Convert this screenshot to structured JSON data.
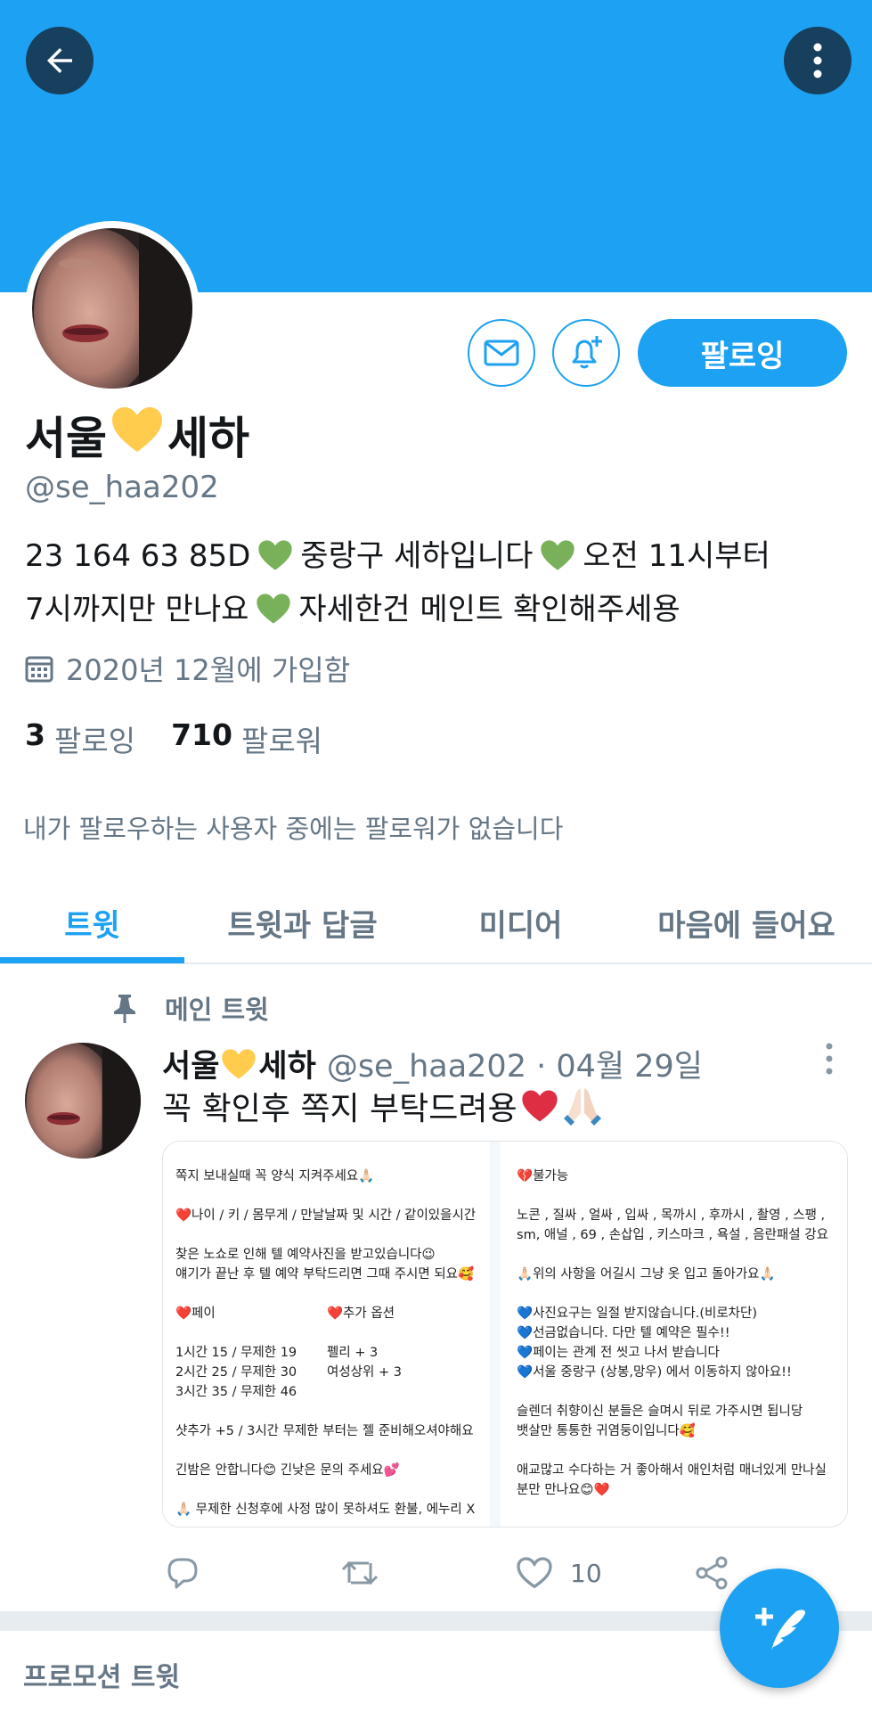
{
  "profile": {
    "display_name_part1": "서울",
    "display_name_part2": "세하",
    "handle": "@se_haa202",
    "bio_line1_a": "23 164 63 85D",
    "bio_line1_b": "중랑구 세하입니다",
    "bio_line1_c": "오전 11시부터",
    "bio_line2_a": "7시까지만 만나요",
    "bio_line2_b": "자세한건 메인트 확인해주세용",
    "joined": "2020년 12월에 가입함",
    "following_count": "3",
    "following_label": "팔로잉",
    "followers_count": "710",
    "followers_label": "팔로워",
    "mutual_note": "내가 팔로우하는 사용자 중에는 팔로워가 없습니다"
  },
  "actions": {
    "follow_button": "팔로잉"
  },
  "tabs": [
    {
      "label": "트윗"
    },
    {
      "label": "트윗과 답글"
    },
    {
      "label": "미디어"
    },
    {
      "label": "마음에 들어요"
    }
  ],
  "tweet": {
    "pinned_label": "메인 트윗",
    "name_part1": "서울",
    "name_part2": "세하",
    "meta": "@se_haa202 · 04월 29일",
    "text": "꼭 확인후 쪽지 부탁드려용",
    "like_count": "10",
    "image_left": {
      "l1": "쪽지 보내실때 꼭 양식 지켜주세요🙏🏻",
      "l2": "❤️나이 / 키 / 몸무게 / 만날날짜 및 시간 / 같이있을시간",
      "l3": "찾은 노쇼로 인해 텔 예약사진을 받고있습니다😉",
      "l4": "얘기가 끝난 후 텔 예약 부탁드리면 그때 주시면 되요🥰",
      "h1": "❤️페이",
      "h2": "❤️추가 옵션",
      "p1": "1시간 15 /  무제한 19",
      "p2": "2시간 25 / 무제한 30",
      "p3": "3시간 35 / 무제한 46",
      "o1": "펠리 + 3",
      "o2": "여성상위 + 3",
      "l5": "샷추가 +5    / 3시간 무제한 부터는 젤 준비해오셔야해요",
      "l6": "긴밤은 안합니다😊  긴낮은 문의 주세요💕",
      "l7": "🙏🏻 무제한 신청후에 사정 많이 못하셔도 환불, 에누리 X"
    },
    "image_right": {
      "r1": "💔불가능",
      "r2": "노콘 , 질싸 , 얼싸 , 입싸 , 목까시 , 후까시 , 촬영 , 스팽 ,",
      "r3": "sm, 애널 , 69 , 손삽입 , 키스마크 , 욕설 , 음란패설 강요",
      "r4": "🙏🏻위의 사항을 어길시 그냥 옷 입고 돌아가요🙏🏻",
      "r5": "💙사진요구는 일절 받지않습니다.(비로차단)",
      "r6": "💙선금없습니다. 다만 텔 예약은 필수!!",
      "r7": "💙페이는 관계 전 씻고 나서 받습니다",
      "r8": "💙서울 중랑구 (상봉,망우) 에서 이동하지 않아요!!",
      "r9": "슬렌더 취향이신 분들은 슬며시 뒤로 가주시면 됩니당",
      "r10": "뱃살만 통통한 귀염둥이입니다🥰",
      "r11": "애교많고 수다하는 거 좋아해서 애인처럼 매너있게 만나실",
      "r12": "분만 만나요😊❤️"
    }
  },
  "promo": {
    "label": "프로모션 트윗"
  },
  "colors": {
    "accent": "#1da1f2",
    "banner": "#1da1f2",
    "secondary_text": "#657786",
    "dark_button": "#17405e"
  }
}
